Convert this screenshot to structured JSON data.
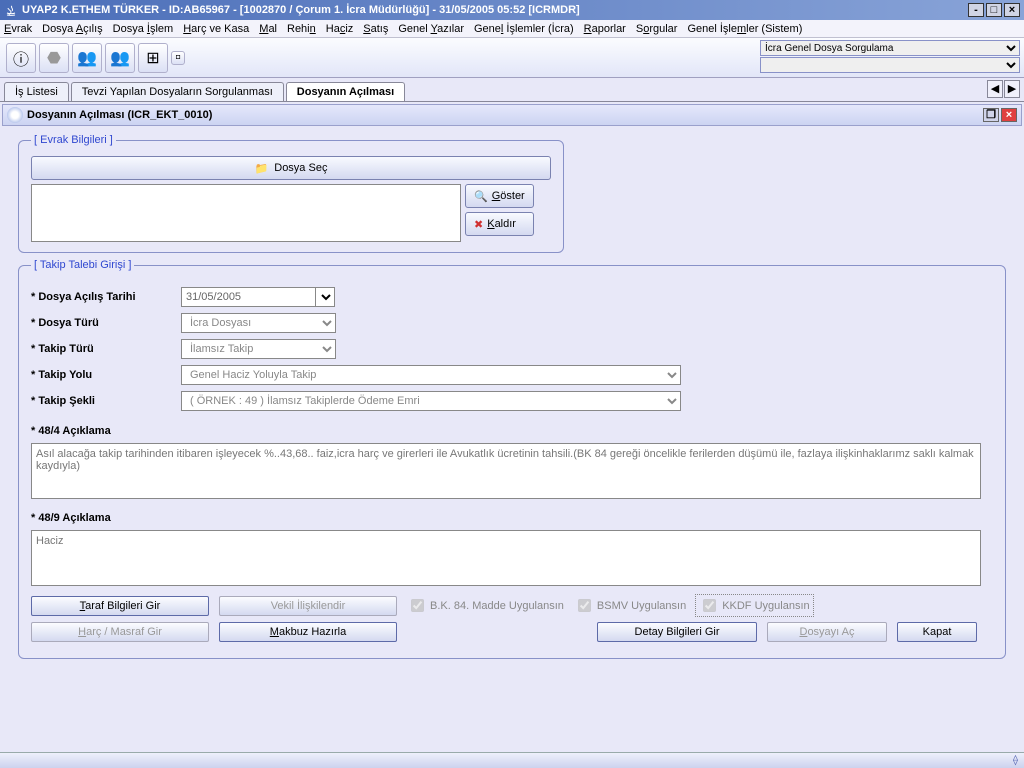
{
  "title": "UYAP2   K.ETHEM TÜRKER - ID:AB65967 - [1002870 / Çorum 1. İcra Müdürlüğü] - 31/05/2005 05:52 [ICRMDR]",
  "menus": [
    "Evrak",
    "Dosya Açılış",
    "Dosya İşlem",
    "Harç ve Kasa",
    "Mal",
    "Rehin",
    "Haciz",
    "Satış",
    "Genel Yazılar",
    "Genel İşlemler (İcra)",
    "Raporlar",
    "Sorgular",
    "Genel İşlemler (Sistem)"
  ],
  "topcombo": "İcra Genel Dosya Sorgulama",
  "tabs": {
    "a": "İş Listesi",
    "b": "Tevzi Yapılan Dosyaların Sorgulanması",
    "c": "Dosyanın Açılması"
  },
  "subheader": "Dosyanın Açılması (ICR_EKT_0010)",
  "fs1": {
    "legend": "[ Evrak Bilgileri ]",
    "dosyasec": "Dosya Seç",
    "goster": "Göster",
    "kaldir": "Kaldır"
  },
  "fs2": {
    "legend": "[ Takip Talebi Girişi ]",
    "l_tarih": "* Dosya Açılış Tarihi",
    "v_tarih": "31/05/2005",
    "l_turu": "* Dosya Türü",
    "v_turu": "İcra Dosyası",
    "l_takipturu": "* Takip Türü",
    "v_takipturu": "İlamsız Takip",
    "l_takipyolu": "* Takip Yolu",
    "v_takipyolu": "Genel Haciz Yoluyla Takip",
    "l_takipsekli": "* Takip Şekli",
    "v_takipsekli": "( ÖRNEK  : 49 ) İlamsız Takiplerde Ödeme Emri",
    "l_484": "* 48/4 Açıklama",
    "v_484": "Asıl alacağa takip tarihinden itibaren işleyecek %..43,68.. faiz,icra harç ve girerleri ile Avukatlık ücretinin tahsili.(BK 84 gereği öncelikle ferilerden düşümü ile, fazlaya ilişkinhaklarımz saklı kalmak kaydıyla)",
    "l_489": "* 48/9 Açıklama",
    "v_489": "Haciz"
  },
  "btns": {
    "taraf": "Taraf Bilgileri Gir",
    "vekil": "Vekil İlişkilendir",
    "harc": "Harç / Masraf Gir",
    "makbuz": "Makbuz Hazırla",
    "detay": "Detay Bilgileri Gir",
    "dosyayiac": "Dosyayı Aç",
    "kapat": "Kapat"
  },
  "checks": {
    "bk84": "B.K. 84. Madde Uygulansın",
    "bsmv": "BSMV Uygulansın",
    "kkdf": "KKDF Uygulansın"
  }
}
